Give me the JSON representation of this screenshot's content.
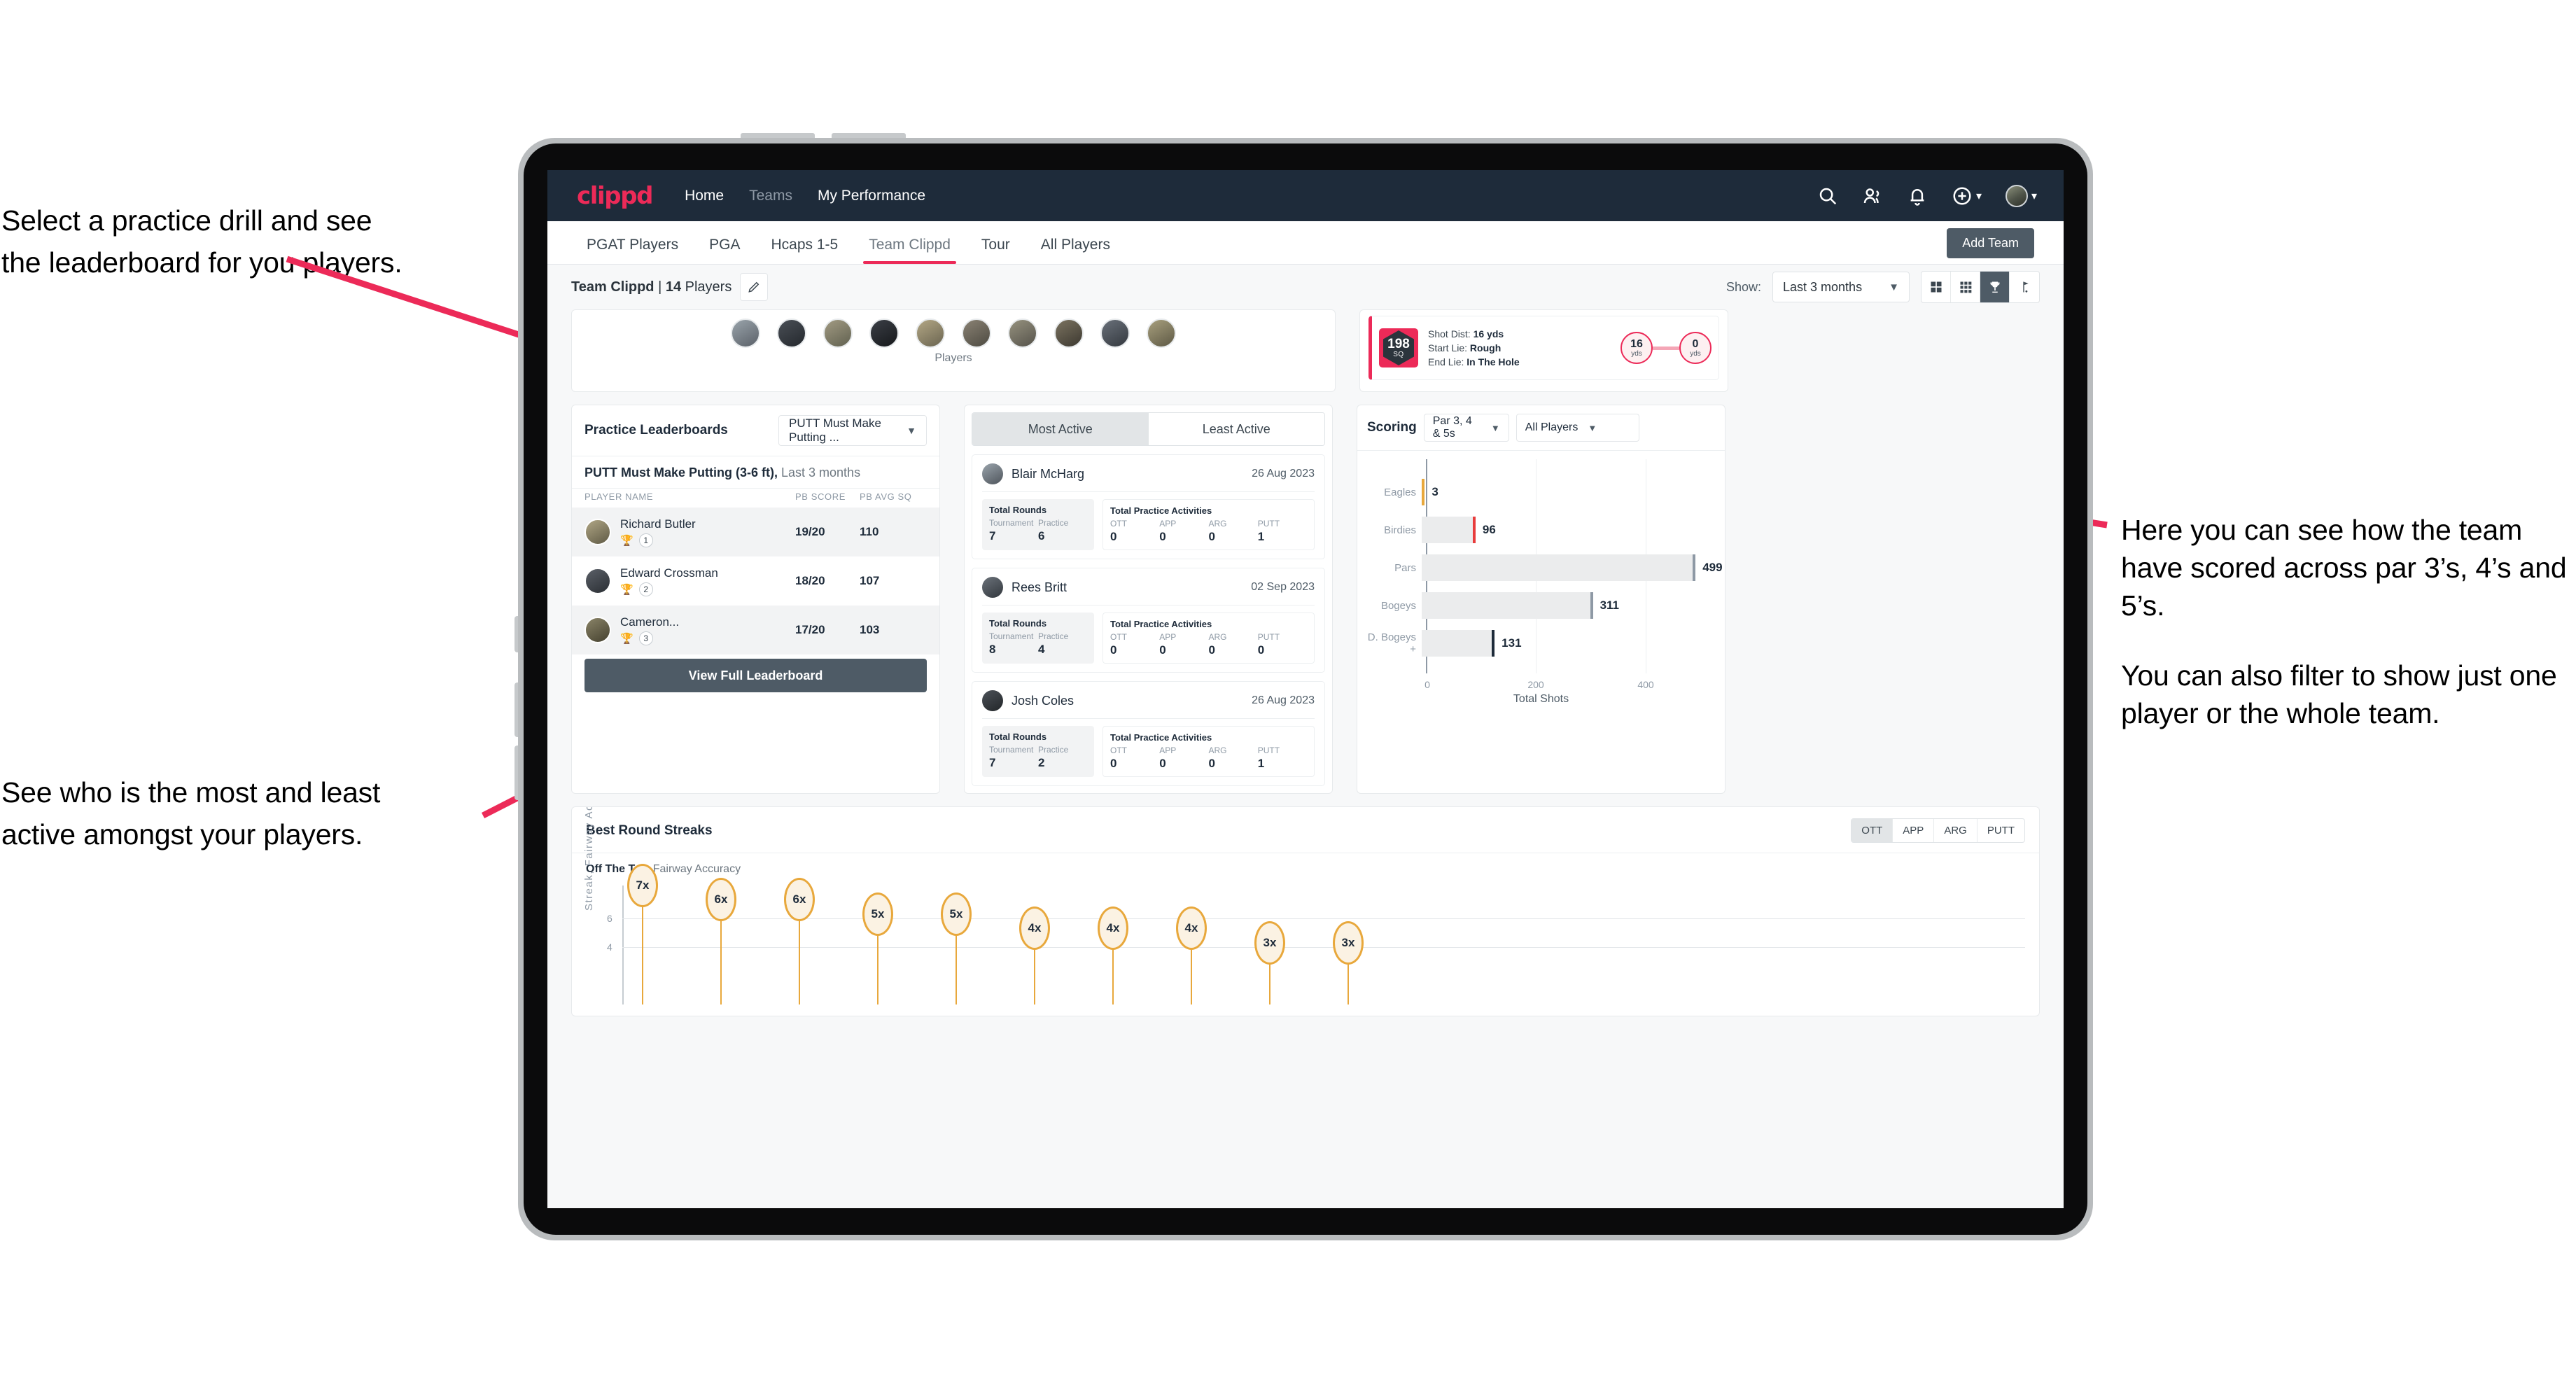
{
  "annotations": {
    "left_top": [
      "Select a practice drill and see",
      "the leaderboard for you players."
    ],
    "left_bottom": [
      "See who is the most and least",
      "active amongst your players."
    ],
    "right": [
      "Here you can see how the team have scored across par 3’s, 4’s and 5’s.",
      "You can also filter to show just one player or the whole team."
    ]
  },
  "navbar": {
    "logo": "clippd",
    "links": [
      {
        "label": "Home",
        "dim": false
      },
      {
        "label": "Teams",
        "dim": true
      },
      {
        "label": "My Performance",
        "dim": false
      }
    ],
    "icons": [
      "search-icon",
      "people-icon",
      "bell-icon",
      "plus-circle-icon",
      "avatar"
    ]
  },
  "tabs": [
    {
      "label": "PGAT Players",
      "active": false
    },
    {
      "label": "PGA",
      "active": false
    },
    {
      "label": "Hcaps 1-5",
      "active": false
    },
    {
      "label": "Team Clippd",
      "active": true
    },
    {
      "label": "Tour",
      "active": false
    },
    {
      "label": "All Players",
      "active": false
    }
  ],
  "add_team_label": "Add Team",
  "subbar": {
    "team_name": "Team Clippd",
    "team_sep": " | ",
    "player_count": "14",
    "players_word": " Players",
    "show_label": "Show:",
    "show_value": "Last 3 months",
    "view_icons": [
      "grid-large-icon",
      "grid-small-icon",
      "trophy-icon",
      "golf-flag-icon"
    ],
    "active_view": "trophy-icon"
  },
  "players_card": {
    "caption": "Players",
    "avatar_count": 10,
    "avatar_colors": [
      "#7d8a92",
      "#3b3f46",
      "#8a8470",
      "#2f3338",
      "#9a9076",
      "#6e6a5c",
      "#7a7263",
      "#5c5348",
      "#4a4e54",
      "#8b8468"
    ]
  },
  "shot_card": {
    "sq_value": "198",
    "sq_unit": "SQ",
    "lines": [
      {
        "label": "Shot Dist:",
        "value": "16 yds"
      },
      {
        "label": "Start Lie:",
        "value": "Rough"
      },
      {
        "label": "End Lie:",
        "value": "In The Hole"
      }
    ],
    "start_dist": {
      "value": "16",
      "unit": "yds"
    },
    "end_dist": {
      "value": "0",
      "unit": "yds"
    }
  },
  "leaderboard": {
    "title": "Practice Leaderboards",
    "drill_select": "PUTT Must Make Putting ...",
    "subtitle_bold": "PUTT Must Make Putting (3-6 ft),",
    "subtitle_rest": " Last 3 months",
    "columns": [
      "PLAYER NAME",
      "PB SCORE",
      "PB AVG SQ"
    ],
    "rows": [
      {
        "name": "Richard Butler",
        "rank": "1",
        "trophy": "gold",
        "pb_score": "19/20",
        "pb_avg_sq": "110",
        "avatar": "#8c8468"
      },
      {
        "name": "Edward Crossman",
        "rank": "2",
        "trophy": "silver",
        "pb_score": "18/20",
        "pb_avg_sq": "107",
        "avatar": "#41474d"
      },
      {
        "name": "Cameron...",
        "rank": "3",
        "trophy": "bronze",
        "pb_score": "17/20",
        "pb_avg_sq": "103",
        "avatar": "#6f6a52"
      }
    ],
    "button_label": "View Full Leaderboard"
  },
  "activity": {
    "tabs": [
      {
        "label": "Most Active",
        "active": true
      },
      {
        "label": "Least Active",
        "active": false
      }
    ],
    "rounds_title": "Total Rounds",
    "practice_title": "Total Practice Activities",
    "rounds_keys": [
      "Tournament",
      "Practice"
    ],
    "practice_keys": [
      "OTT",
      "APP",
      "ARG",
      "PUTT"
    ],
    "items": [
      {
        "name": "Blair McHarg",
        "date": "26 Aug 2023",
        "avatar": "#8f9aa3",
        "tournament": "7",
        "practice": "6",
        "ott": "0",
        "app": "0",
        "arg": "0",
        "putt": "1"
      },
      {
        "name": "Rees Britt",
        "date": "02 Sep 2023",
        "avatar": "#5c6168",
        "tournament": "8",
        "practice": "4",
        "ott": "0",
        "app": "0",
        "arg": "0",
        "putt": "0"
      },
      {
        "name": "Josh Coles",
        "date": "26 Aug 2023",
        "avatar": "#3e4349",
        "tournament": "7",
        "practice": "2",
        "ott": "0",
        "app": "0",
        "arg": "0",
        "putt": "1"
      }
    ]
  },
  "scoring": {
    "title": "Scoring",
    "par_select": "Par 3, 4 & 5s",
    "player_select": "All Players"
  },
  "streaks": {
    "title": "Best Round Streaks",
    "toggles": [
      {
        "label": "OTT",
        "active": true
      },
      {
        "label": "APP",
        "active": false
      },
      {
        "label": "ARG",
        "active": false
      },
      {
        "label": "PUTT",
        "active": false
      }
    ],
    "sub_bold": "Off The Tee,",
    "sub_rest": " Fairway Accuracy"
  },
  "chart_data": [
    {
      "type": "bar",
      "orientation": "horizontal",
      "title": "Scoring",
      "categories": [
        "Eagles",
        "Birdies",
        "Pars",
        "Bogeys",
        "D. Bogeys +"
      ],
      "values": [
        3,
        96,
        499,
        311,
        131
      ],
      "cap_colors": [
        "#e8a83c",
        "#e83c3c",
        "#8e99a5",
        "#8e99a5",
        "#1e2b3a"
      ],
      "xlabel": "Total Shots",
      "ylabel": "",
      "xlim": [
        0,
        520
      ],
      "xticks": [
        0,
        200,
        400
      ],
      "grid": true,
      "legend": "none"
    },
    {
      "type": "bar",
      "orientation": "vertical",
      "title": "Best Round Streaks",
      "subtitle": "Off The Tee, Fairway Accuracy",
      "ylabel": "Streak, Fairway Accuracy",
      "categories": [
        "",
        "",
        "",
        "",
        "",
        "",
        "",
        "",
        "",
        ""
      ],
      "values": [
        7,
        6,
        6,
        5,
        5,
        4,
        4,
        4,
        3,
        3
      ],
      "labels": [
        "7x",
        "6x",
        "6x",
        "5x",
        "5x",
        "4x",
        "4x",
        "4x",
        "3x",
        "3x"
      ],
      "yticks": [
        4,
        6
      ],
      "ylim": [
        0,
        8
      ],
      "grid": true,
      "legend": "none"
    }
  ]
}
